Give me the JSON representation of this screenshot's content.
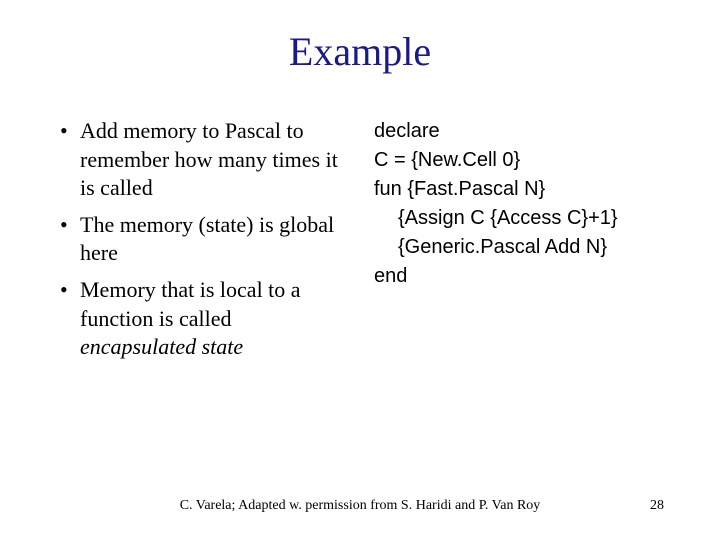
{
  "title": "Example",
  "bullets": [
    {
      "pre": "Add memory to Pascal to remember how many times it is called",
      "ital": ""
    },
    {
      "pre": "The memory (state) is global here",
      "ital": ""
    },
    {
      "pre": "Memory that is local to a function is called ",
      "ital": "encapsulated state"
    }
  ],
  "code": {
    "l1": "declare",
    "l2": "C = {New.Cell 0}",
    "l3": "fun {Fast.Pascal N}",
    "l4": "{Assign C {Access C}+1}",
    "l5": "{Generic.Pascal Add N}",
    "l6": "end"
  },
  "footer": {
    "credit": "C. Varela;  Adapted w. permission from S. Haridi and P. Van Roy",
    "page": "28"
  }
}
